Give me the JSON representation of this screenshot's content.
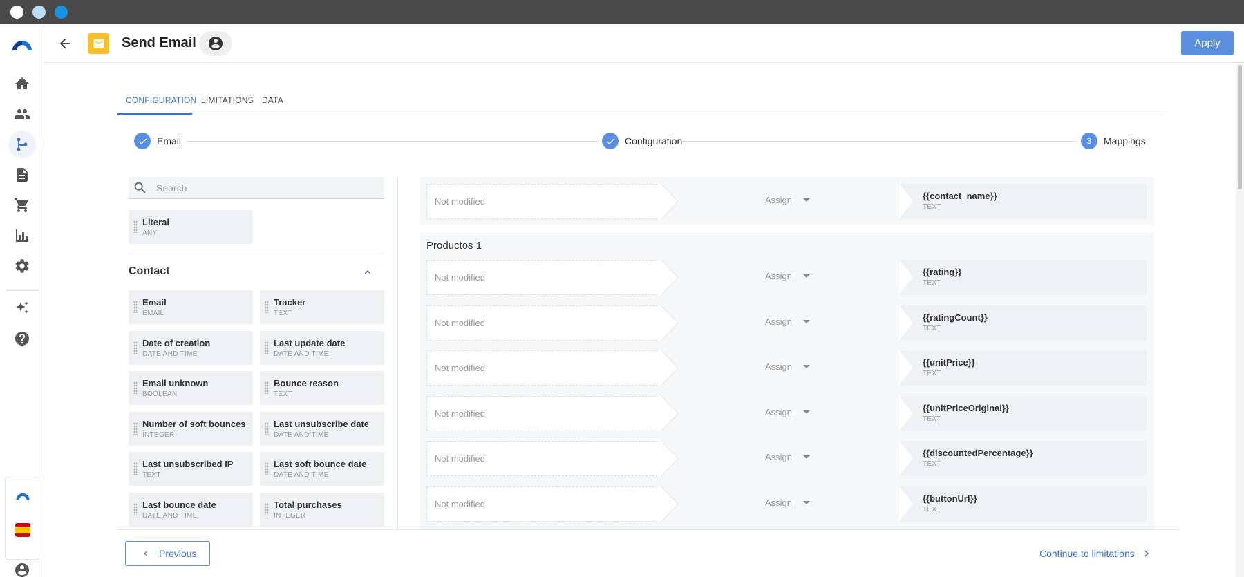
{
  "window": {
    "dots": [
      "#ffffff",
      "#b9dcf7",
      "#1793e6"
    ]
  },
  "header": {
    "title": "Send Email",
    "apply_label": "Apply"
  },
  "tabs": [
    {
      "label": "CONFIGURATION",
      "active": true
    },
    {
      "label": "LIMITATIONS",
      "active": false
    },
    {
      "label": "DATA",
      "active": false
    }
  ],
  "stepper": {
    "steps": [
      {
        "label": "Email",
        "state": "done"
      },
      {
        "label": "Configuration",
        "state": "done"
      },
      {
        "label": "Mappings",
        "state": "current",
        "number": "3"
      }
    ]
  },
  "palette": {
    "search_placeholder": "Search",
    "literal": {
      "name": "Literal",
      "type": "ANY"
    },
    "section_title": "Contact",
    "fields": [
      {
        "name": "Email",
        "type": "EMAIL"
      },
      {
        "name": "Tracker",
        "type": "TEXT"
      },
      {
        "name": "Date of creation",
        "type": "DATE AND TIME"
      },
      {
        "name": "Last update date",
        "type": "DATE AND TIME"
      },
      {
        "name": "Email unknown",
        "type": "BOOLEAN"
      },
      {
        "name": "Bounce reason",
        "type": "TEXT"
      },
      {
        "name": "Number of soft bounces",
        "type": "INTEGER"
      },
      {
        "name": "Last unsubscribe date",
        "type": "DATE AND TIME"
      },
      {
        "name": "Last unsubscribed IP",
        "type": "TEXT"
      },
      {
        "name": "Last soft bounce date",
        "type": "DATE AND TIME"
      },
      {
        "name": "Last bounce date",
        "type": "DATE AND TIME"
      },
      {
        "name": "Total purchases",
        "type": "INTEGER"
      }
    ]
  },
  "mappings": {
    "top_row": {
      "source": "Not modified",
      "op": "Assign",
      "target": "{{contact_name}}",
      "type": "TEXT"
    },
    "group_title": "Productos 1",
    "rows": [
      {
        "source": "Not modified",
        "op": "Assign",
        "target": "{{rating}}",
        "type": "TEXT"
      },
      {
        "source": "Not modified",
        "op": "Assign",
        "target": "{{ratingCount}}",
        "type": "TEXT"
      },
      {
        "source": "Not modified",
        "op": "Assign",
        "target": "{{unitPrice}}",
        "type": "TEXT"
      },
      {
        "source": "Not modified",
        "op": "Assign",
        "target": "{{unitPriceOriginal}}",
        "type": "TEXT"
      },
      {
        "source": "Not modified",
        "op": "Assign",
        "target": "{{discountedPercentage}}",
        "type": "TEXT"
      },
      {
        "source": "Not modified",
        "op": "Assign",
        "target": "{{buttonUrl}}",
        "type": "TEXT"
      }
    ]
  },
  "footer": {
    "previous_label": "Previous",
    "continue_label": "Continue to limitations"
  },
  "colors": {
    "accent": "#5a8fe0",
    "badge": "#f6bf2f",
    "titlebar": "#4a4a4a"
  }
}
